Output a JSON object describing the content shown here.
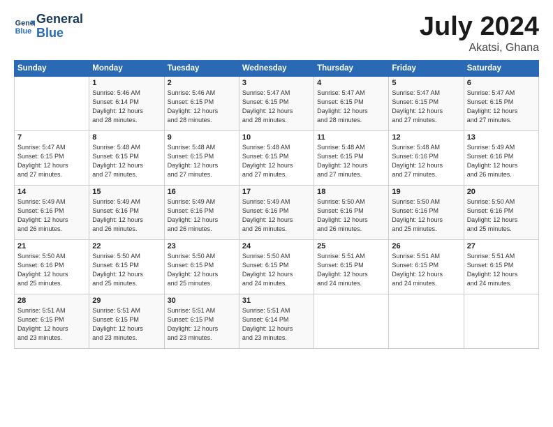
{
  "header": {
    "logo_line1": "General",
    "logo_line2": "Blue",
    "month": "July 2024",
    "location": "Akatsi, Ghana"
  },
  "weekdays": [
    "Sunday",
    "Monday",
    "Tuesday",
    "Wednesday",
    "Thursday",
    "Friday",
    "Saturday"
  ],
  "weeks": [
    [
      {
        "day": "",
        "info": ""
      },
      {
        "day": "1",
        "info": "Sunrise: 5:46 AM\nSunset: 6:14 PM\nDaylight: 12 hours\nand 28 minutes."
      },
      {
        "day": "2",
        "info": "Sunrise: 5:46 AM\nSunset: 6:15 PM\nDaylight: 12 hours\nand 28 minutes."
      },
      {
        "day": "3",
        "info": "Sunrise: 5:47 AM\nSunset: 6:15 PM\nDaylight: 12 hours\nand 28 minutes."
      },
      {
        "day": "4",
        "info": "Sunrise: 5:47 AM\nSunset: 6:15 PM\nDaylight: 12 hours\nand 28 minutes."
      },
      {
        "day": "5",
        "info": "Sunrise: 5:47 AM\nSunset: 6:15 PM\nDaylight: 12 hours\nand 27 minutes."
      },
      {
        "day": "6",
        "info": "Sunrise: 5:47 AM\nSunset: 6:15 PM\nDaylight: 12 hours\nand 27 minutes."
      }
    ],
    [
      {
        "day": "7",
        "info": "Sunrise: 5:47 AM\nSunset: 6:15 PM\nDaylight: 12 hours\nand 27 minutes."
      },
      {
        "day": "8",
        "info": "Sunrise: 5:48 AM\nSunset: 6:15 PM\nDaylight: 12 hours\nand 27 minutes."
      },
      {
        "day": "9",
        "info": "Sunrise: 5:48 AM\nSunset: 6:15 PM\nDaylight: 12 hours\nand 27 minutes."
      },
      {
        "day": "10",
        "info": "Sunrise: 5:48 AM\nSunset: 6:15 PM\nDaylight: 12 hours\nand 27 minutes."
      },
      {
        "day": "11",
        "info": "Sunrise: 5:48 AM\nSunset: 6:15 PM\nDaylight: 12 hours\nand 27 minutes."
      },
      {
        "day": "12",
        "info": "Sunrise: 5:48 AM\nSunset: 6:16 PM\nDaylight: 12 hours\nand 27 minutes."
      },
      {
        "day": "13",
        "info": "Sunrise: 5:49 AM\nSunset: 6:16 PM\nDaylight: 12 hours\nand 26 minutes."
      }
    ],
    [
      {
        "day": "14",
        "info": "Sunrise: 5:49 AM\nSunset: 6:16 PM\nDaylight: 12 hours\nand 26 minutes."
      },
      {
        "day": "15",
        "info": "Sunrise: 5:49 AM\nSunset: 6:16 PM\nDaylight: 12 hours\nand 26 minutes."
      },
      {
        "day": "16",
        "info": "Sunrise: 5:49 AM\nSunset: 6:16 PM\nDaylight: 12 hours\nand 26 minutes."
      },
      {
        "day": "17",
        "info": "Sunrise: 5:49 AM\nSunset: 6:16 PM\nDaylight: 12 hours\nand 26 minutes."
      },
      {
        "day": "18",
        "info": "Sunrise: 5:50 AM\nSunset: 6:16 PM\nDaylight: 12 hours\nand 26 minutes."
      },
      {
        "day": "19",
        "info": "Sunrise: 5:50 AM\nSunset: 6:16 PM\nDaylight: 12 hours\nand 25 minutes."
      },
      {
        "day": "20",
        "info": "Sunrise: 5:50 AM\nSunset: 6:16 PM\nDaylight: 12 hours\nand 25 minutes."
      }
    ],
    [
      {
        "day": "21",
        "info": "Sunrise: 5:50 AM\nSunset: 6:16 PM\nDaylight: 12 hours\nand 25 minutes."
      },
      {
        "day": "22",
        "info": "Sunrise: 5:50 AM\nSunset: 6:15 PM\nDaylight: 12 hours\nand 25 minutes."
      },
      {
        "day": "23",
        "info": "Sunrise: 5:50 AM\nSunset: 6:15 PM\nDaylight: 12 hours\nand 25 minutes."
      },
      {
        "day": "24",
        "info": "Sunrise: 5:50 AM\nSunset: 6:15 PM\nDaylight: 12 hours\nand 24 minutes."
      },
      {
        "day": "25",
        "info": "Sunrise: 5:51 AM\nSunset: 6:15 PM\nDaylight: 12 hours\nand 24 minutes."
      },
      {
        "day": "26",
        "info": "Sunrise: 5:51 AM\nSunset: 6:15 PM\nDaylight: 12 hours\nand 24 minutes."
      },
      {
        "day": "27",
        "info": "Sunrise: 5:51 AM\nSunset: 6:15 PM\nDaylight: 12 hours\nand 24 minutes."
      }
    ],
    [
      {
        "day": "28",
        "info": "Sunrise: 5:51 AM\nSunset: 6:15 PM\nDaylight: 12 hours\nand 23 minutes."
      },
      {
        "day": "29",
        "info": "Sunrise: 5:51 AM\nSunset: 6:15 PM\nDaylight: 12 hours\nand 23 minutes."
      },
      {
        "day": "30",
        "info": "Sunrise: 5:51 AM\nSunset: 6:15 PM\nDaylight: 12 hours\nand 23 minutes."
      },
      {
        "day": "31",
        "info": "Sunrise: 5:51 AM\nSunset: 6:14 PM\nDaylight: 12 hours\nand 23 minutes."
      },
      {
        "day": "",
        "info": ""
      },
      {
        "day": "",
        "info": ""
      },
      {
        "day": "",
        "info": ""
      }
    ]
  ]
}
